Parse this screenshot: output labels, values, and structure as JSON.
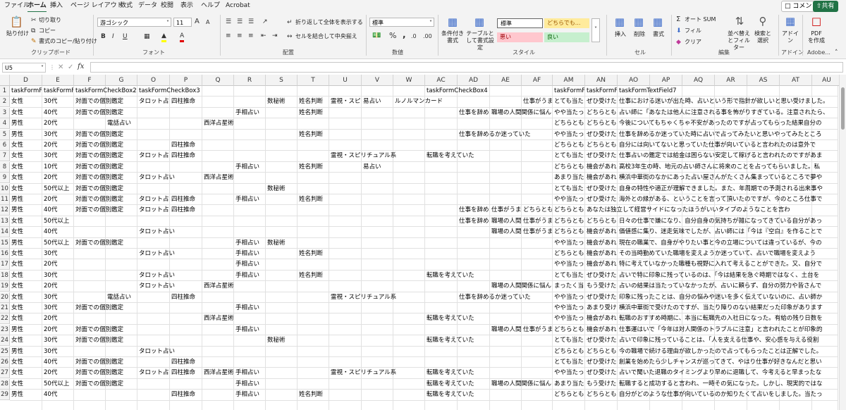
{
  "menu": {
    "tabs": [
      "ファイル",
      "ホーム",
      "挿入",
      "ページ レイアウト",
      "数式",
      "データ",
      "校閲",
      "表示",
      "ヘルプ",
      "Acrobat"
    ],
    "active": 1,
    "comment": "コメント",
    "share": "共有"
  },
  "ribbon": {
    "clipboard": {
      "paste": "貼り付け",
      "cut": "切り取り",
      "copy": "コピー",
      "format_painter": "書式のコピー/貼り付け",
      "label": "クリップボード"
    },
    "font": {
      "name": "游ゴシック",
      "size": "11",
      "label": "フォント",
      "bold": "B",
      "italic": "I",
      "underline": "U",
      "grow": "A",
      "shrink": "A"
    },
    "alignment": {
      "wrap": "折り返して全体を表示する",
      "merge": "セルを結合して中央揃え",
      "label": "配置"
    },
    "number": {
      "format": "標準",
      "percent": "%",
      "comma": ",",
      "label": "数値"
    },
    "styles": {
      "cond": "条件付き書式",
      "table": "テーブルとして書式設定",
      "normal": "標準",
      "neutral": "どちらでも...",
      "bad": "悪い",
      "good": "良い",
      "label": "スタイル"
    },
    "cells": {
      "insert": "挿入",
      "delete": "削除",
      "format": "書式",
      "label": "セル"
    },
    "editing": {
      "autosum": "オート SUM",
      "fill": "フィル",
      "clear": "クリア",
      "sort": "並べ替えとフィルター",
      "find": "検索と選択",
      "label": "編集"
    },
    "addins": {
      "addin": "アドイン",
      "label": "アドイン"
    },
    "adobe": {
      "pdf": "PDF を作成",
      "label": "Adobe..."
    }
  },
  "formula_bar": {
    "cell_ref": "U5",
    "fx": "fx",
    "value": ""
  },
  "sheet": {
    "columns": [
      "D",
      "E",
      "F",
      "G",
      "O",
      "P",
      "Q",
      "R",
      "S",
      "T",
      "U",
      "V",
      "W",
      "AC",
      "AD",
      "AE",
      "AF",
      "AM",
      "AN",
      "AO",
      "AP",
      "AQ",
      "AR",
      "AS",
      "AT",
      "AU"
    ],
    "rows": [
      [
        "taskFormF",
        "taskFormF",
        "taskFormCheckBox2",
        "",
        "taskFormCheckBox3",
        "",
        "",
        "",
        "",
        "",
        "",
        "",
        "",
        "taskFormCheckBox4",
        "",
        "",
        "",
        "taskFormF",
        "taskFormF",
        "taskFormTextField7",
        "",
        "",
        "",
        "",
        "",
        ""
      ],
      [
        "女性",
        "30代",
        "対面での個別鑑定",
        "",
        "タロット占い",
        "四柱推命",
        "",
        "",
        "数秘術",
        "姓名判断",
        "霊視・スピ",
        "易占い",
        "ルノルマンカード",
        "",
        "",
        "",
        "仕事がうま",
        "とても当た",
        "ぜひ受けた",
        "仕事における迷いが出た時、占いという形で指針が欲しいと思い受けました。",
        "",
        "",
        "",
        "",
        "",
        ""
      ],
      [
        "女性",
        "40代",
        "対面での個別鑑定",
        "",
        "",
        "",
        "",
        "手相占い",
        "",
        "姓名判断",
        "",
        "",
        "",
        "",
        "仕事を辞め",
        "職場の人間関係に悩ん",
        "",
        "やや当たっ",
        "どちらとも",
        "占い師に「あなたは他人に注意される事を怖がりすぎている。注意されたら、",
        "",
        "",
        "",
        "",
        "",
        ""
      ],
      [
        "男性",
        "20代",
        "",
        "電話占い",
        "",
        "",
        "西洋占星術",
        "",
        "",
        "",
        "",
        "",
        "",
        "",
        "",
        "",
        "",
        "どちらとも",
        "どちらとも",
        "今後についてもちゃくちゃ不安があったのですが占ってもらった結果自分の",
        "",
        "",
        "",
        "",
        "",
        ""
      ],
      [
        "男性",
        "30代",
        "対面での個別鑑定",
        "",
        "",
        "",
        "",
        "",
        "",
        "姓名判断",
        "",
        "",
        "",
        "",
        "仕事を辞めるか迷っていた",
        "",
        "",
        "やや当たっ",
        "ぜひ受けた",
        "仕事を辞めるか迷っていた時に占いで占ってみたいと思いやってみたところ",
        "",
        "",
        "",
        "",
        "",
        ""
      ],
      [
        "女性",
        "20代",
        "対面での個別鑑定",
        "",
        "",
        "四柱推命",
        "",
        "",
        "",
        "",
        "",
        "",
        "",
        "",
        "",
        "",
        "",
        "どちらとも",
        "どちらとも",
        "自分には向いてないと思っていた仕事が向いていると言われたのは意外で",
        "",
        "",
        "",
        "",
        "",
        ""
      ],
      [
        "女性",
        "30代",
        "対面での個別鑑定",
        "",
        "タロット占い",
        "四柱推命",
        "",
        "",
        "",
        "",
        "霊視・スピリチュアル系",
        "",
        "",
        "転職を考えていた",
        "",
        "",
        "",
        "とても当た",
        "ぜひ受けた",
        "仕事占いの鑑定では給金は困らない安定して稼げると言われたのですがあま",
        "",
        "",
        "",
        "",
        "",
        ""
      ],
      [
        "女性",
        "10代",
        "対面での個別鑑定",
        "",
        "",
        "",
        "",
        "手相占い",
        "",
        "姓名判断",
        "",
        "易占い",
        "",
        "",
        "",
        "",
        "",
        "どちらとも",
        "機会があれ",
        "高校3年生の時、地元の占い師さんに将来のことを占ってもらいました。私",
        "",
        "",
        "",
        "",
        "",
        ""
      ],
      [
        "女性",
        "20代",
        "対面での個別鑑定",
        "",
        "タロット占い",
        "",
        "西洋占星術",
        "",
        "",
        "",
        "",
        "",
        "",
        "",
        "",
        "",
        "",
        "あまり当た",
        "機会があれ",
        "横浜中華街のなかにあった占い屋さんがたくさん集まっているところで夢や",
        "",
        "",
        "",
        "",
        "",
        ""
      ],
      [
        "女性",
        "50代以上",
        "対面での個別鑑定",
        "",
        "",
        "",
        "",
        "",
        "数秘術",
        "",
        "",
        "",
        "",
        "",
        "",
        "",
        "",
        "とても当た",
        "ぜひ受けた",
        "自身の特性や適正が理解できました。また、年周期での予測される出来事や",
        "",
        "",
        "",
        "",
        "",
        ""
      ],
      [
        "男性",
        "20代",
        "対面での個別鑑定",
        "",
        "タロット占い",
        "四柱推命",
        "",
        "手相占い",
        "",
        "姓名判断",
        "",
        "",
        "",
        "",
        "",
        "",
        "",
        "やや当たっ",
        "ぜひ受けた",
        "海外との縁がある、ということを言って頂いたのですが、今のところ仕事で",
        "",
        "",
        "",
        "",
        "",
        ""
      ],
      [
        "男性",
        "40代",
        "対面での個別鑑定",
        "",
        "タロット占い",
        "四柱推命",
        "",
        "",
        "",
        "",
        "",
        "",
        "",
        "",
        "仕事を辞めるか迷っていた",
        "仕事がうま",
        "どちらとも",
        "どちらとも",
        "あなたは独立して経営サイドになったほうがいいタイプのようなことを言わ",
        "",
        "",
        "",
        "",
        "",
        ""
      ],
      [
        "女性",
        "50代以上",
        "",
        "",
        "",
        "",
        "",
        "",
        "",
        "",
        "",
        "",
        "",
        "",
        "仕事を辞め",
        "職場の人間",
        "仕事がうま",
        "どちらとも",
        "どちらとも",
        "日々の仕事で嫌になり、自分自身の気持ちが雑になってきている自分があっ",
        "",
        "",
        "",
        "",
        "",
        ""
      ],
      [
        "女性",
        "40代",
        "",
        "",
        "タロット占い",
        "",
        "",
        "",
        "",
        "",
        "",
        "",
        "",
        "",
        "",
        "職場の人間",
        "仕事がうま",
        "どちらとも",
        "機会があれ",
        "価値感に集り、迷走気味でしたが、占い師には「今は『空白』を作ることで",
        "",
        "",
        "",
        "",
        "",
        ""
      ],
      [
        "男性",
        "50代以上",
        "対面での個別鑑定",
        "",
        "",
        "",
        "",
        "手相占い",
        "数秘術",
        "",
        "",
        "",
        "",
        "",
        "",
        "",
        "",
        "やや当たっ",
        "機会があれ",
        "現在の職業で、自身がやりたい事と今の立場については違っているが、今の",
        "",
        "",
        "",
        "",
        "",
        ""
      ],
      [
        "女性",
        "30代",
        "",
        "",
        "タロット占い",
        "",
        "",
        "手相占い",
        "",
        "姓名判断",
        "",
        "",
        "",
        "",
        "",
        "",
        "",
        "どちらとも",
        "機会があれ",
        "その当時勤めていた職場を変えようか迷っていて、占いで職場を変えよう",
        "",
        "",
        "",
        "",
        "",
        ""
      ],
      [
        "女性",
        "20代",
        "",
        "",
        "",
        "",
        "",
        "手相占い",
        "",
        "",
        "",
        "",
        "",
        "",
        "",
        "",
        "",
        "やや当たっ",
        "機会があれ",
        "特に考えていなかった職種も視野に入れて考えることができた。又、自分で",
        "",
        "",
        "",
        "",
        "",
        ""
      ],
      [
        "女性",
        "30代",
        "",
        "",
        "タロット占い",
        "",
        "",
        "手相占い",
        "",
        "姓名判断",
        "",
        "",
        "",
        "転職を考えていた",
        "",
        "",
        "",
        "とても当た",
        "ぜひ受けた",
        "占いで特に印象に残っているのは、「今は結果を急ぐ時期ではなく、土台を",
        "",
        "",
        "",
        "",
        "",
        ""
      ],
      [
        "女性",
        "20代",
        "",
        "",
        "タロット占い",
        "",
        "西洋占星術",
        "",
        "",
        "",
        "",
        "",
        "",
        "",
        "",
        "職場の人間関係に悩ん",
        "",
        "まったく当",
        "もう受けた",
        "占いの結果は当たっていなかったが、占いに頼らず、自分の努力や皆さんで",
        "",
        "",
        "",
        "",
        "",
        ""
      ],
      [
        "女性",
        "30代",
        "",
        "電話占い",
        "",
        "四柱推命",
        "",
        "",
        "",
        "",
        "霊視・スピリチュアル系",
        "",
        "",
        "",
        "仕事を辞めるか迷っていた",
        "",
        "",
        "やや当たっ",
        "ぜひ受けた",
        "印象に残ったことは、自分の悩みや迷いを多く伝えていないのに、占い師か",
        "",
        "",
        "",
        "",
        "",
        ""
      ],
      [
        "女性",
        "30代",
        "対面での個別鑑定",
        "",
        "",
        "",
        "",
        "手相占い",
        "",
        "",
        "",
        "",
        "",
        "",
        "",
        "",
        "",
        "やや当たっ",
        "あまり受け",
        "横浜中華街で受けたのですが、当たり障りのない結果だった印象があります",
        "",
        "",
        "",
        "",
        "",
        ""
      ],
      [
        "女性",
        "20代",
        "",
        "",
        "",
        "",
        "西洋占星術",
        "",
        "",
        "",
        "",
        "",
        "",
        "転職を考えていた",
        "",
        "",
        "",
        "やや当たっ",
        "機会があれ",
        "転職のおすすめ時期に、本当に転職先の入社日になった。有給の残り日数を",
        "",
        "",
        "",
        "",
        "",
        ""
      ],
      [
        "男性",
        "20代",
        "対面での個別鑑定",
        "",
        "",
        "",
        "",
        "手相占い",
        "",
        "",
        "",
        "",
        "",
        "",
        "",
        "職場の人間",
        "仕事がうま",
        "どちらとも",
        "機会があれ",
        "仕事運はいで「今年は対人関係のトラブルに注意」と言われたことが印象的",
        "",
        "",
        "",
        "",
        "",
        ""
      ],
      [
        "女性",
        "30代",
        "対面での個別鑑定",
        "",
        "",
        "",
        "",
        "",
        "数秘術",
        "",
        "",
        "",
        "",
        "転職を考えていた",
        "",
        "",
        "",
        "とても当た",
        "ぜひ受けた",
        "占いで印象に残っていることは、「人を支える仕事や、安心感を与える役割",
        "",
        "",
        "",
        "",
        "",
        ""
      ],
      [
        "男性",
        "30代",
        "",
        "",
        "タロット占い",
        "",
        "",
        "",
        "",
        "",
        "",
        "",
        "",
        "",
        "",
        "",
        "",
        "どちらとも",
        "どちらとも",
        "今の職場で続ける理由が欲しかったので占ってもらったことは正解でした。",
        "",
        "",
        "",
        "",
        "",
        ""
      ],
      [
        "女性",
        "40代",
        "対面での個別鑑定",
        "",
        "",
        "四柱推命",
        "",
        "",
        "",
        "",
        "",
        "",
        "",
        "",
        "",
        "",
        "",
        "とても当た",
        "ぜひ受けた",
        "創業を始めたら少しチャンスが巡ってきて、やはり仕事が好きなんだと思い",
        "",
        "",
        "",
        "",
        "",
        ""
      ],
      [
        "女性",
        "20代",
        "対面での個別鑑定",
        "",
        "タロット占い",
        "四柱推命",
        "西洋占星術",
        "手相占い",
        "",
        "",
        "霊視・スピリチュアル系",
        "",
        "",
        "転職を考えていた",
        "",
        "",
        "",
        "やや当たっ",
        "ぜひ受けた",
        "占いで聞いた退職のタイミングより早めに退職して、今考えると早まったな",
        "",
        "",
        "",
        "",
        "",
        ""
      ],
      [
        "女性",
        "50代以上",
        "対面での個別鑑定",
        "",
        "",
        "",
        "",
        "手相占い",
        "",
        "",
        "",
        "",
        "",
        "転職を考えていた",
        "",
        "職場の人間関係に悩ん",
        "",
        "あまり当た",
        "もう受けた",
        "転職すると成功すると言われ、一時その気になった。しかし、現実的ではな",
        "",
        "",
        "",
        "",
        "",
        ""
      ],
      [
        "男性",
        "40代",
        "",
        "",
        "",
        "四柱推命",
        "",
        "手相占い",
        "",
        "姓名判断",
        "",
        "",
        "",
        "転職を考えていた",
        "",
        "",
        "",
        "どちらとも",
        "どちらとも",
        "自分がどのような仕事が向いているのか知りたくて占いをしました。当たっ",
        "",
        "",
        "",
        "",
        "",
        ""
      ]
    ]
  }
}
